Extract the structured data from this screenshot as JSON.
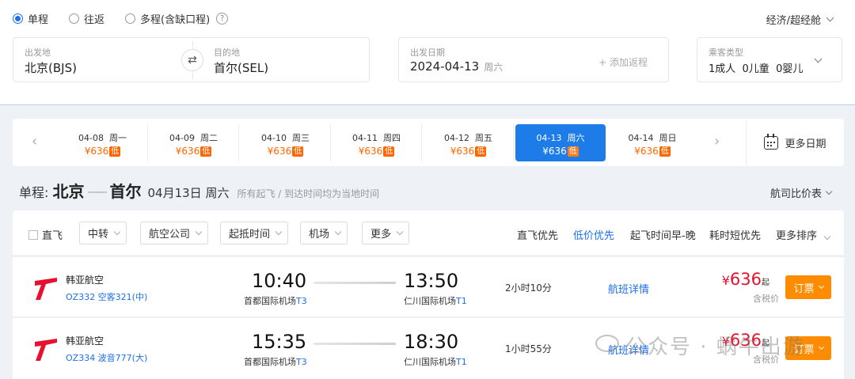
{
  "trip_types": [
    "单程",
    "往返",
    "多程(含缺口程)"
  ],
  "cabin": "经济/超经舱",
  "origin": {
    "label": "出发地",
    "value": "北京(BJS)"
  },
  "destination": {
    "label": "目的地",
    "value": "首尔(SEL)"
  },
  "depart": {
    "label": "出发日期",
    "value": "2024-04-13",
    "weekday": "周六",
    "add_return": "+ 添加返程"
  },
  "passengers": {
    "label": "乘客类型",
    "value": "1成人  0儿童  0婴儿"
  },
  "date_strip": {
    "days": [
      {
        "date": "04-08  周一",
        "price": "¥636",
        "tag": "低"
      },
      {
        "date": "04-09  周二",
        "price": "¥636",
        "tag": "低"
      },
      {
        "date": "04-10  周三",
        "price": "¥636",
        "tag": "低"
      },
      {
        "date": "04-11  周四",
        "price": "¥636",
        "tag": "低"
      },
      {
        "date": "04-12  周五",
        "price": "¥636",
        "tag": "低"
      },
      {
        "date": "04-13  周六",
        "price": "¥636",
        "tag": "低"
      },
      {
        "date": "04-14  周日",
        "price": "¥636",
        "tag": "低"
      }
    ],
    "selected_index": 5,
    "more_dates": "更多日期"
  },
  "route": {
    "prefix": "单程:",
    "from": "北京",
    "to": "首尔",
    "date": "04月13日 周六",
    "note": "所有起飞 / 到达时间均为当地时间",
    "compare": "航司比价表"
  },
  "filters": {
    "direct": "直飞",
    "buttons": [
      "中转",
      "航空公司",
      "起抵时间",
      "机场",
      "更多"
    ],
    "sorts": [
      "直飞优先",
      "低价优先",
      "起飞时间早-晚",
      "耗时短优先",
      "更多排序"
    ],
    "active_sort": 1
  },
  "flights": [
    {
      "airline": "韩亚航空",
      "flight_no": "OZ332 空客321(中)",
      "dep_time": "10:40",
      "dep_airport": "首都国际机场",
      "dep_terminal": "T3",
      "arr_time": "13:50",
      "arr_airport": "仁川国际机场",
      "arr_terminal": "T1",
      "duration": "2小时10分",
      "detail": "航班详情",
      "price": "636",
      "currency": "¥",
      "qi": "起",
      "tax": "含税价",
      "book": "订票"
    },
    {
      "airline": "韩亚航空",
      "flight_no": "OZ334 波音777(大)",
      "dep_time": "15:35",
      "dep_airport": "首都国际机场",
      "dep_terminal": "T3",
      "arr_time": "18:30",
      "arr_airport": "仁川国际机场",
      "arr_terminal": "T1",
      "duration": "1小时55分",
      "detail": "航班详情",
      "price": "636",
      "currency": "¥",
      "qi": "起",
      "tax": "含税价",
      "book": "订票"
    }
  ],
  "watermark": "公众号 · 蜗牛出游",
  "colors": {
    "accent": "#1d6ee8",
    "price": "#e8112d",
    "book": "#ff8c00",
    "low_tag": "#ff6600",
    "airline_logo": "#e8112d"
  },
  "icons": {
    "help": "question-circle-icon",
    "swap": "swap-arrows-icon",
    "calendar": "calendar-icon",
    "logo": "asiana-wing-icon"
  }
}
